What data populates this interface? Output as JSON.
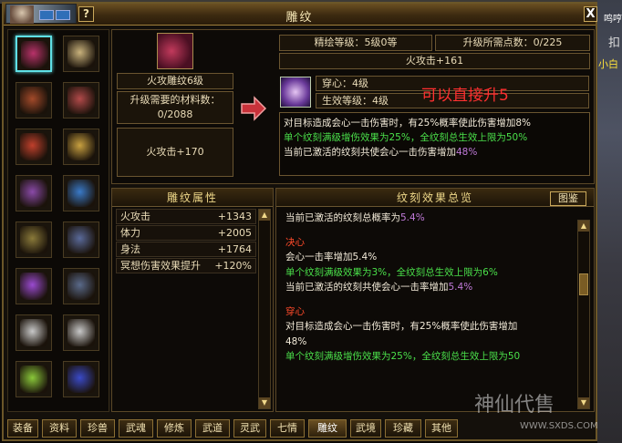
{
  "window": {
    "title": "雕纹",
    "help_label": "?",
    "close_label": "X"
  },
  "scene": {
    "text_right": "鸣哼",
    "text_gold": "小白",
    "text_side": "扣"
  },
  "items": [
    {
      "name": "item-carving-1",
      "color": "#b8326a"
    },
    {
      "name": "item-ring",
      "color": "#c9b27c"
    },
    {
      "name": "item-beast-mask",
      "color": "#a34a2a"
    },
    {
      "name": "item-bracelet",
      "color": "#b24a4a"
    },
    {
      "name": "item-red-scroll",
      "color": "#c0402c"
    },
    {
      "name": "item-gold-scroll",
      "color": "#c8a040"
    },
    {
      "name": "item-purple-claw",
      "color": "#8a4aa8"
    },
    {
      "name": "item-blue-sword",
      "color": "#3a7ac8"
    },
    {
      "name": "item-belt",
      "color": "#8a7a3a"
    },
    {
      "name": "item-gauntlet",
      "color": "#5a6a9a"
    },
    {
      "name": "item-purple-blade",
      "color": "#9a4ad0"
    },
    {
      "name": "item-boots",
      "color": "#5a6a8a"
    },
    {
      "name": "item-white-ornament",
      "color": "#c8c8c8"
    },
    {
      "name": "item-white-ornament-2",
      "color": "#c8c8c8"
    },
    {
      "name": "item-amulet",
      "color": "#8ac83a"
    },
    {
      "name": "item-blue-crest",
      "color": "#3a4ac8"
    }
  ],
  "detail": {
    "carve_name": "火攻雕纹6级",
    "materials_label": "升级需要的材料数：",
    "materials_value": "0/2088",
    "current_attr": "火攻击+170",
    "refine_level": "精绘等级：5级0等",
    "upgrade_points": "升级所需点数：0/225",
    "next_attr": "火攻击+161",
    "pierce": "穿心：4级",
    "effect_level": "生效等级：4级",
    "annotation": "可以直接升5",
    "desc": [
      {
        "text": "对目标造成会心一击伤害时，有25%概率使此伤害增加8%",
        "color": "white"
      },
      {
        "text": "单个纹刻满级增伤效果为25%，全纹刻总生效上限为50%",
        "color": "green"
      },
      {
        "text": "当前已激活的纹刻共使会心一击伤害增加",
        "color": "white",
        "suffix": "48%"
      }
    ]
  },
  "attributes": {
    "header": "雕纹属性",
    "rows": [
      {
        "name": "火攻击",
        "value": "+1343"
      },
      {
        "name": "体力",
        "value": "+2005"
      },
      {
        "name": "身法",
        "value": "+1764"
      },
      {
        "name": "冥想伤害效果提升",
        "value": "+120%"
      }
    ]
  },
  "effects": {
    "header": "纹刻效果总览",
    "tujian_label": "图鉴",
    "lines": [
      {
        "text": "当前已激活的纹刻总概率为",
        "color": "white",
        "suffix": "5.4%"
      },
      {
        "spacer": true
      },
      {
        "text": "决心",
        "color": "red"
      },
      {
        "text": "会心一击率增加5.4%",
        "color": "white"
      },
      {
        "text": "单个纹刻满级效果为3%，全纹刻总生效上限为6%",
        "color": "green"
      },
      {
        "text": "当前已激活的纹刻共使会心一击率增加",
        "color": "white",
        "suffix": "5.4%"
      },
      {
        "spacer": true
      },
      {
        "text": "穿心",
        "color": "red"
      },
      {
        "text": "对目标造成会心一击伤害时，有25%概率使此伤害增加",
        "color": "white"
      },
      {
        "text": "48%",
        "color": "white"
      },
      {
        "text": "单个纹刻满级增伤效果为25%，全纹刻总生效上限为50",
        "color": "green"
      }
    ]
  },
  "tabs": [
    {
      "label": "装备",
      "active": false
    },
    {
      "label": "资料",
      "active": false
    },
    {
      "label": "珍兽",
      "active": false
    },
    {
      "label": "武魂",
      "active": false
    },
    {
      "label": "修炼",
      "active": false
    },
    {
      "label": "武道",
      "active": false
    },
    {
      "label": "灵武",
      "active": false
    },
    {
      "label": "七情",
      "active": false
    },
    {
      "label": "雕纹",
      "active": true
    },
    {
      "label": "武境",
      "active": false
    },
    {
      "label": "珍藏",
      "active": false
    },
    {
      "label": "其他",
      "active": false
    }
  ],
  "watermark": {
    "text": "神仙代售",
    "url": "WWW.SXDS.COM"
  }
}
